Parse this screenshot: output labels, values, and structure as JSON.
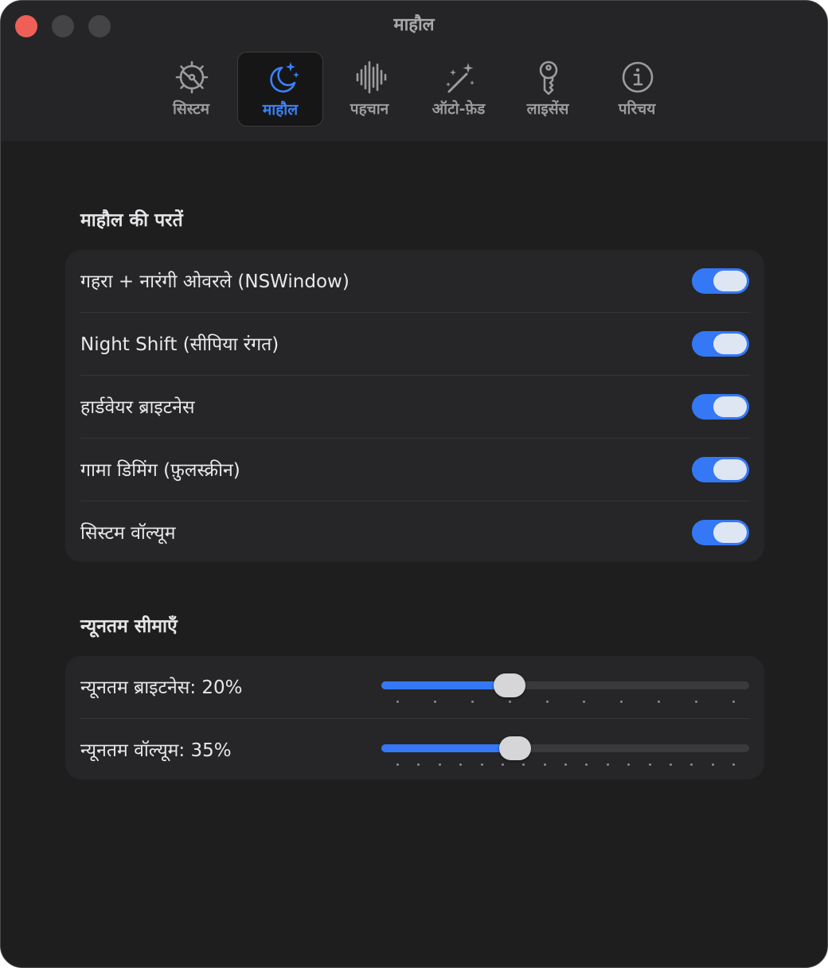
{
  "window": {
    "title": "माहौल"
  },
  "tabs": [
    {
      "label": "सिस्टम",
      "icon": "gear-icon",
      "selected": false
    },
    {
      "label": "माहौल",
      "icon": "moon-stars-icon",
      "selected": true
    },
    {
      "label": "पहचान",
      "icon": "waveform-icon",
      "selected": false
    },
    {
      "label": "ऑटो-फ़ेड",
      "icon": "magic-wand-icon",
      "selected": false
    },
    {
      "label": "लाइसेंस",
      "icon": "key-icon",
      "selected": false
    },
    {
      "label": "परिचय",
      "icon": "info-icon",
      "selected": false
    }
  ],
  "layers": {
    "title": "माहौल की परतें",
    "items": [
      {
        "label": "गहरा + नारंगी ओवरले (NSWindow)",
        "enabled": true
      },
      {
        "label": "Night Shift (सीपिया रंगत)",
        "enabled": true
      },
      {
        "label": "हार्डवेयर ब्राइटनेस",
        "enabled": true
      },
      {
        "label": "गामा डिमिंग (फ़ुलस्क्रीन)",
        "enabled": true
      },
      {
        "label": "सिस्टम वॉल्यूम",
        "enabled": true
      }
    ]
  },
  "limits": {
    "title": "न्यूनतम सीमाएँ",
    "sliders": [
      {
        "label": "न्यूनतम ब्राइटनेस: 20%",
        "value": 20,
        "min": 5,
        "max": 50,
        "ticks": 10
      },
      {
        "label": "न्यूनतम वॉल्यूम: 35%",
        "value": 35,
        "min": 0,
        "max": 100,
        "ticks": 17
      }
    ]
  },
  "colors": {
    "accent": "#3478f6",
    "background": "#1e1e1f",
    "group_background": "#262628",
    "close_button": "#ed5f57"
  }
}
